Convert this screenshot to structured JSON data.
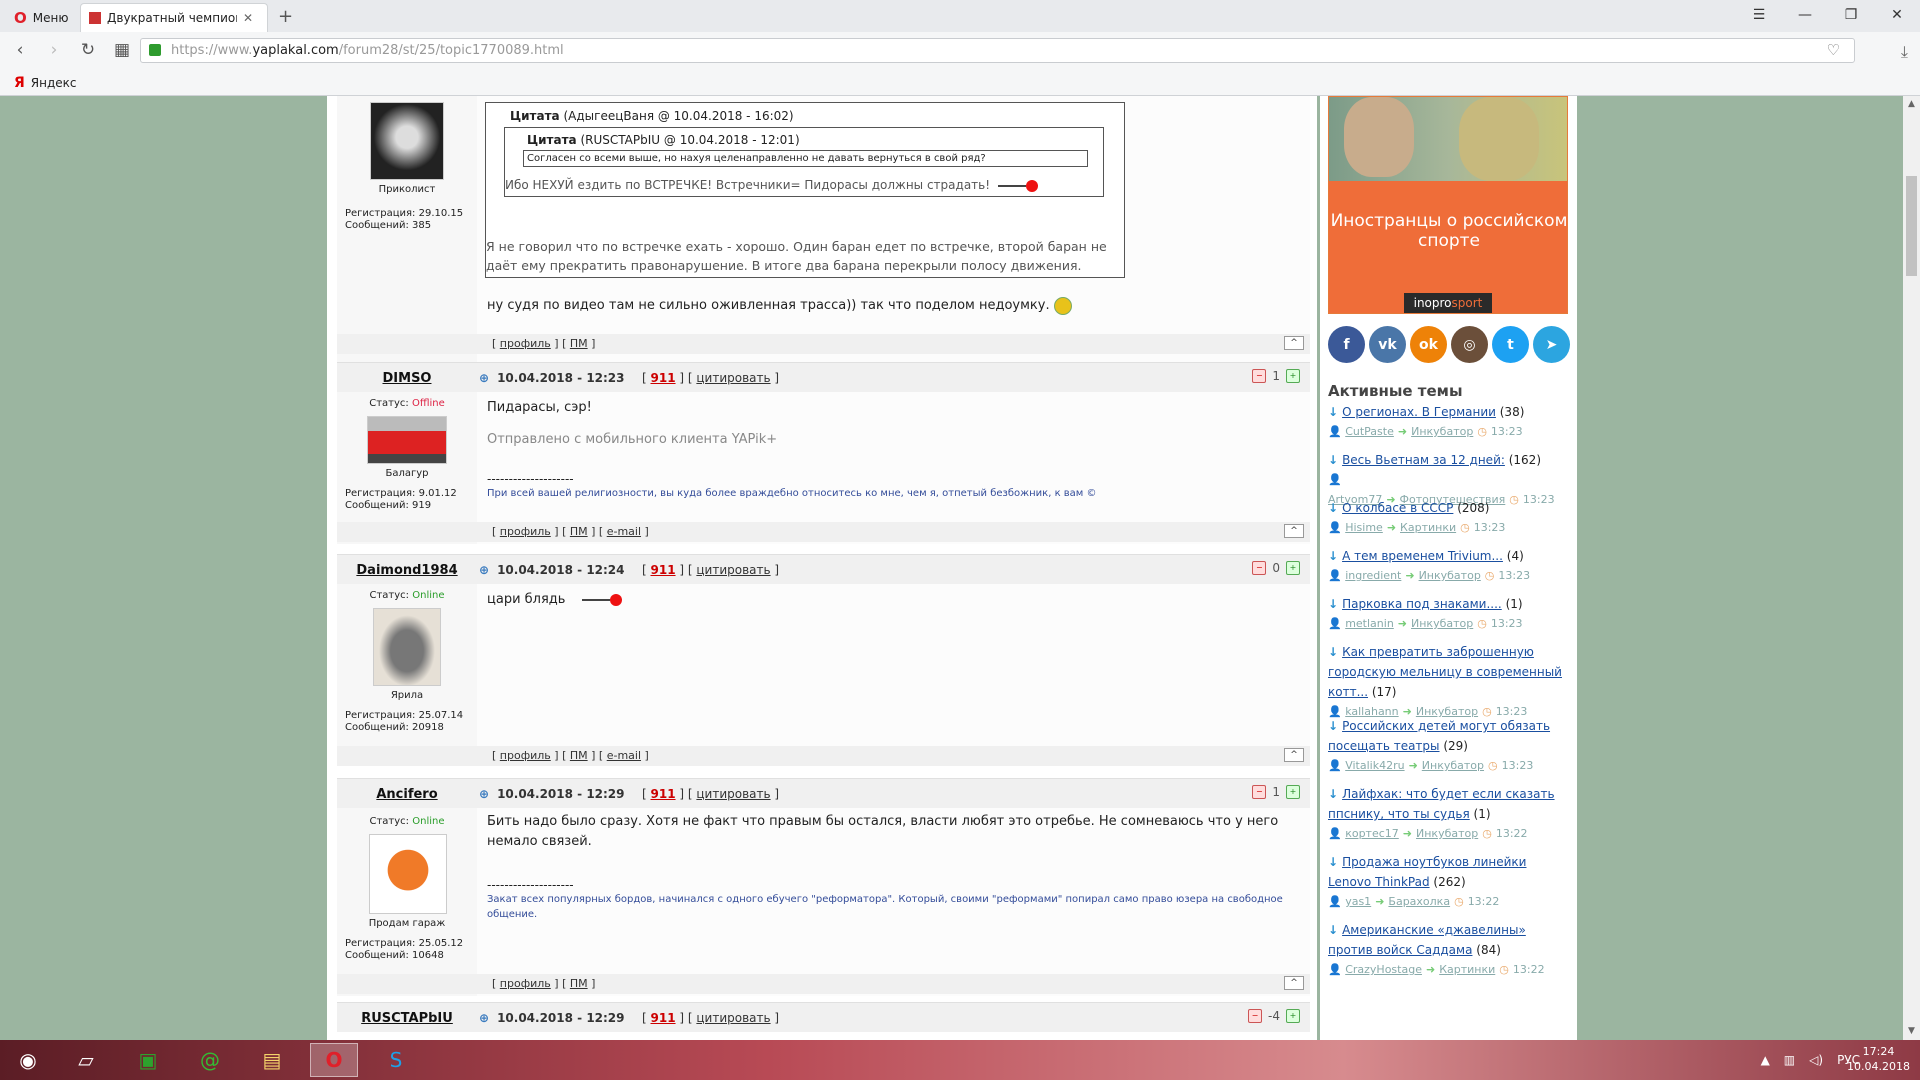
{
  "browser": {
    "menu_label": "Меню",
    "tab_title": "Двукратный чемпион ми",
    "url_scheme": "https://www.",
    "url_host": "yaplakal.com",
    "url_path": "/forum28/st/25/topic1770089.html",
    "bookmark_yandex": "Яндекс"
  },
  "posts": {
    "prev": {
      "rank": "Приколист",
      "reg": "Регистрация: 29.10.15",
      "msgs": "Сообщений: 385",
      "quote_outer_author": "(АдыгеецВаня @ 10.04.2018 - 16:02)",
      "quote_inner_author": "(RUSCTAPbIU @ 10.04.2018 - 12:01)",
      "quote_label": "Цитата",
      "quote_inner_text": "Согласен со всеми выше, но нахуя целенаправленно не давать вернуться в свой ряд?",
      "quote_outer_text": "Ибо НЕХУЙ ездить по ВСТРЕЧКЕ! Встречники= Пидорасы должны страдать!",
      "quote_reply": "Я не говорил что по встречке ехать - хорошо. Один баран едет по встречке, второй баран не даёт ему прекратить правонарушение. В итоге два барана перекрыли полосу движения.",
      "text": "ну судя по видео там не сильно оживленная трасса)) так что поделом недоумку.",
      "footer_profile": "профиль",
      "footer_pm": "ПМ"
    },
    "dimso": {
      "name": "DIMSO",
      "status_label": "Статус:",
      "status": "Offline",
      "rank": "Балагур",
      "reg": "Регистрация: 9.01.12",
      "msgs": "Сообщений: 919",
      "date": "10.04.2018 - 12:23",
      "n911": "911",
      "quote_btn": "цитировать",
      "rating": "1",
      "text": "Пидарасы, сэр!",
      "mobile": "Отправлено с мобильного клиента YAPik+",
      "dash": "--------------------",
      "sig": "При всей вашей религиозности, вы куда более враждебно относитесь ко мне, чем я, отпетый безбожник, к вам ©",
      "footer_profile": "профиль",
      "footer_pm": "ПМ",
      "footer_email": "e-mail"
    },
    "daimond": {
      "name": "Daimond1984",
      "status_label": "Статус:",
      "status": "Online",
      "rank": "Ярила",
      "reg": "Регистрация: 25.07.14",
      "msgs": "Сообщений: 20918",
      "date": "10.04.2018 - 12:24",
      "n911": "911",
      "quote_btn": "цитировать",
      "rating": "0",
      "text": "цари блядь",
      "footer_profile": "профиль",
      "footer_pm": "ПМ",
      "footer_email": "e-mail"
    },
    "ancifero": {
      "name": "Ancifero",
      "status_label": "Статус:",
      "status": "Online",
      "rank": "Продам гараж",
      "reg": "Регистрация: 25.05.12",
      "msgs": "Сообщений: 10648",
      "date": "10.04.2018 - 12:29",
      "n911": "911",
      "quote_btn": "цитировать",
      "rating": "1",
      "text": "Бить надо было сразу. Хотя не факт что правым бы остался, власти любят это отребье. Не сомневаюсь что у него немало связей.",
      "dash": "--------------------",
      "sig": "Закат всех популярных бордов, начинался с одного ебучего \"реформатора\". Который, своими \"реформами\" попирал само право юзера на свободное общение.",
      "footer_profile": "профиль",
      "footer_pm": "ПМ"
    },
    "rusctap": {
      "name": "RUSCTAPbIU",
      "date": "10.04.2018 - 12:29",
      "n911": "911",
      "quote_btn": "цитировать",
      "rating": "-4"
    }
  },
  "sidebar": {
    "ad_text": "Иностранцы о российском спорте",
    "ad_brand_a": "ino",
    "ad_brand_b": "pro",
    "ad_brand_c": "sport",
    "social": [
      {
        "name": "facebook-icon",
        "glyph": "f",
        "color": "#3b5998"
      },
      {
        "name": "vk-icon",
        "glyph": "vk",
        "color": "#4a76a8"
      },
      {
        "name": "odnoklassniki-icon",
        "glyph": "ok",
        "color": "#ee8208"
      },
      {
        "name": "instagram-icon",
        "glyph": "◎",
        "color": "#6b4f3a"
      },
      {
        "name": "twitter-icon",
        "glyph": "t",
        "color": "#1da1f2"
      },
      {
        "name": "telegram-icon",
        "glyph": "➤",
        "color": "#2ca5e0"
      }
    ],
    "topics_title": "Активные темы",
    "topics": [
      {
        "title": "О регионах. В Германии",
        "count": "(38)",
        "user": "CutPaste",
        "section": "Инкубатор",
        "time": "13:23"
      },
      {
        "title": "Весь Вьетнам за 12 дней:",
        "count": "(162)",
        "user": "Artyom77",
        "section": "Фотопутешествия",
        "time": "13:23"
      },
      {
        "title": "О колбасе в СССР",
        "count": "(208)",
        "user": "Hisime",
        "section": "Картинки",
        "time": "13:23"
      },
      {
        "title": "А тем временем Trivium...",
        "count": "(4)",
        "user": "ingredient",
        "section": "Инкубатор",
        "time": "13:23"
      },
      {
        "title": "Парковка под знаками....",
        "count": "(1)",
        "user": "metlanin",
        "section": "Инкубатор",
        "time": "13:23"
      },
      {
        "title": "Как превратить заброшенную городскую мельницу в современный котт...",
        "count": "(17)",
        "user": "kallahann",
        "section": "Инкубатор",
        "time": "13:23"
      },
      {
        "title": "Российских детей могут обязать посещать театры",
        "count": "(29)",
        "user": "Vitalik42ru",
        "section": "Инкубатор",
        "time": "13:23"
      },
      {
        "title": "Лайфхак: что будет если сказать ппснику, что ты судья",
        "count": "(1)",
        "user": "кортес17",
        "section": "Инкубатор",
        "time": "13:22"
      },
      {
        "title": "Продажа ноутбуков линейки Lenovo ThinkPad",
        "count": "(262)",
        "user": "yas1",
        "section": "Барахолка",
        "time": "13:22"
      },
      {
        "title": "Американские «джавелины» против войск Саддама",
        "count": "(84)",
        "user": "CrazyHostage",
        "section": "Картинки",
        "time": "13:22"
      }
    ]
  },
  "taskbar": {
    "lang": "РУС",
    "time": "17:24",
    "date": "10.04.2018"
  }
}
